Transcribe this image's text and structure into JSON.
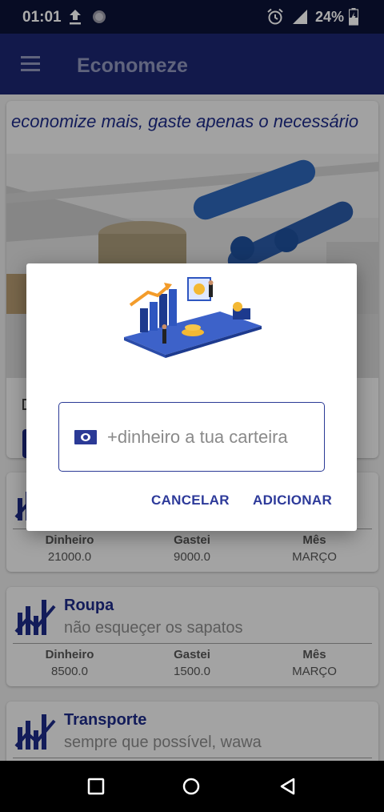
{
  "status_bar": {
    "time": "01:01",
    "battery": "24%",
    "icons": [
      "upload-icon",
      "sync-icon",
      "alarm-icon",
      "signal-icon",
      "battery-icon"
    ]
  },
  "app_bar": {
    "title": "Economeze",
    "menu_icon": "hamburger-menu-icon"
  },
  "hero": {
    "tagline": "economize mais, gaste apenas o necessário"
  },
  "cards": [
    {
      "title": "",
      "subtitle": "",
      "columns": [
        {
          "header": "Dinheiro",
          "value": "21000.0"
        },
        {
          "header": "Gastei",
          "value": "9000.0"
        },
        {
          "header": "Mês",
          "value": "MARÇO"
        }
      ]
    },
    {
      "title": "Roupa",
      "subtitle": "não esqueçer os sapatos",
      "columns": [
        {
          "header": "Dinheiro",
          "value": "8500.0"
        },
        {
          "header": "Gastei",
          "value": "1500.0"
        },
        {
          "header": "Mês",
          "value": "MARÇO"
        }
      ]
    },
    {
      "title": "Transporte",
      "subtitle": "sempre que possível, wawa"
    }
  ],
  "dialog": {
    "input_placeholder": "+dinheiro a tua carteira",
    "input_value": "",
    "cancel_label": "CANCELAR",
    "add_label": "ADICIONAR"
  },
  "colors": {
    "status_bar": "#0b1236",
    "app_bar": "#1b2670",
    "accent": "#2d3a9a",
    "card_title": "#1d2b86"
  }
}
